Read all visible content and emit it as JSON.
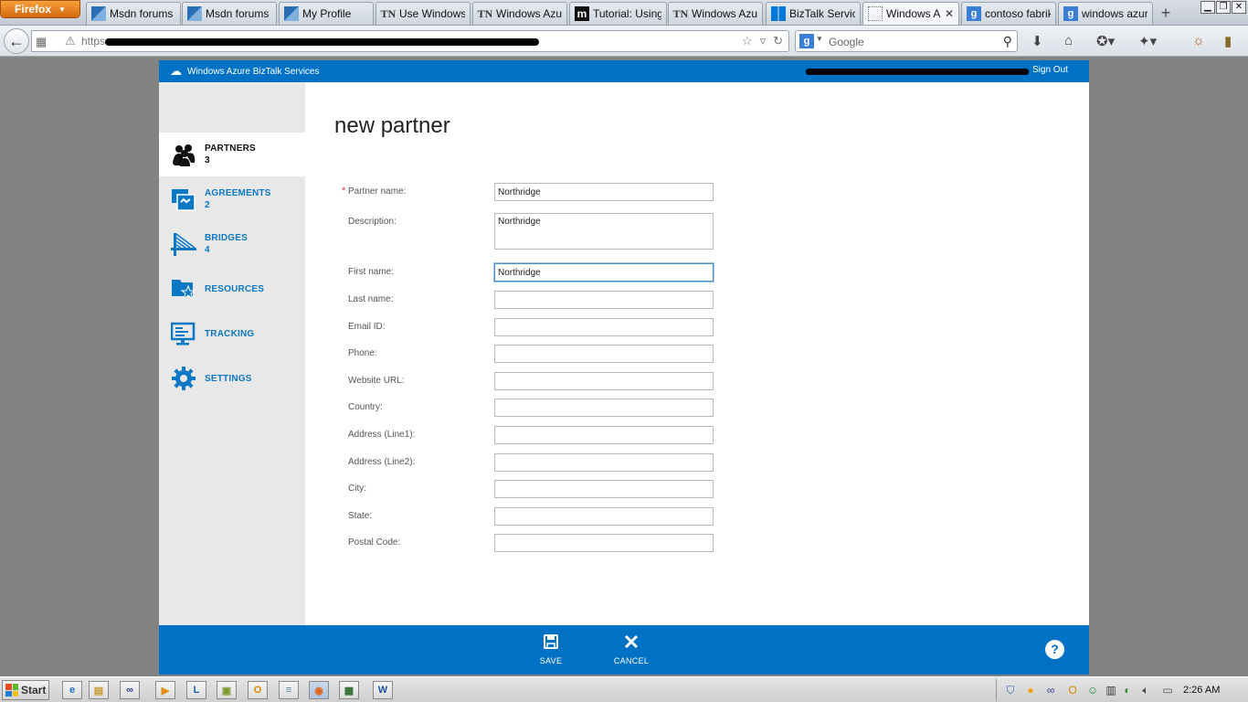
{
  "browser": {
    "app_button": "Firefox",
    "tabs": [
      {
        "icon": "azure-icon",
        "label": "Msdn forums -..."
      },
      {
        "icon": "azure-icon",
        "label": "Msdn forums -..."
      },
      {
        "icon": "azure-icon",
        "label": "My Profile"
      },
      {
        "icon": "technet-icon",
        "label": "Use Windows ..."
      },
      {
        "icon": "technet-icon",
        "label": "Windows Azur..."
      },
      {
        "icon": "m-icon",
        "label": "Tutorial: Using..."
      },
      {
        "icon": "technet-icon",
        "label": "Windows Azur..."
      },
      {
        "icon": "windows-icon",
        "label": "BizTalk Service..."
      },
      {
        "icon": "blank-page-icon",
        "label": "Windows A...",
        "active": true
      },
      {
        "icon": "google-icon",
        "label": "contoso fabrik..."
      },
      {
        "icon": "google-icon",
        "label": "windows azur..."
      }
    ],
    "url_prefix": "https",
    "search_placeholder": "Google"
  },
  "portal": {
    "brand": "Windows Azure BizTalk Services",
    "sign_out": "Sign Out",
    "nav": [
      {
        "label": "PARTNERS",
        "count": "3",
        "icon": "partners-icon",
        "active": true
      },
      {
        "label": "AGREEMENTS",
        "count": "2",
        "icon": "agreements-icon"
      },
      {
        "label": "BRIDGES",
        "count": "4",
        "icon": "bridges-icon"
      },
      {
        "label": "RESOURCES",
        "count": "",
        "icon": "resources-icon"
      },
      {
        "label": "TRACKING",
        "count": "",
        "icon": "tracking-icon"
      },
      {
        "label": "SETTINGS",
        "count": "",
        "icon": "settings-icon"
      }
    ],
    "page_title": "new partner",
    "form": {
      "required_mark": "*",
      "partner_name": {
        "label": "Partner name:",
        "value": "Northridge"
      },
      "description": {
        "label": "Description:",
        "value": "Northridge"
      },
      "first_name": {
        "label": "First name:",
        "value": "Northridge"
      },
      "last_name": {
        "label": "Last name:",
        "value": ""
      },
      "email": {
        "label": "Email ID:",
        "value": ""
      },
      "phone": {
        "label": "Phone:",
        "value": ""
      },
      "website": {
        "label": "Website URL:",
        "value": ""
      },
      "country": {
        "label": "Country:",
        "value": ""
      },
      "address1": {
        "label": "Address (Line1):",
        "value": ""
      },
      "address2": {
        "label": "Address (Line2):",
        "value": ""
      },
      "city": {
        "label": "City:",
        "value": ""
      },
      "state": {
        "label": "State:",
        "value": ""
      },
      "postal": {
        "label": "Postal Code:",
        "value": ""
      }
    },
    "actions": {
      "save": "SAVE",
      "cancel": "CANCEL",
      "help": "?"
    }
  },
  "taskbar": {
    "start": "Start",
    "clock": "2:26 AM"
  },
  "colors": {
    "accent": "#0072c6",
    "nav_text": "#0b78c3",
    "sidebar_bg": "#e8e8e8",
    "required": "#d03b3b"
  }
}
